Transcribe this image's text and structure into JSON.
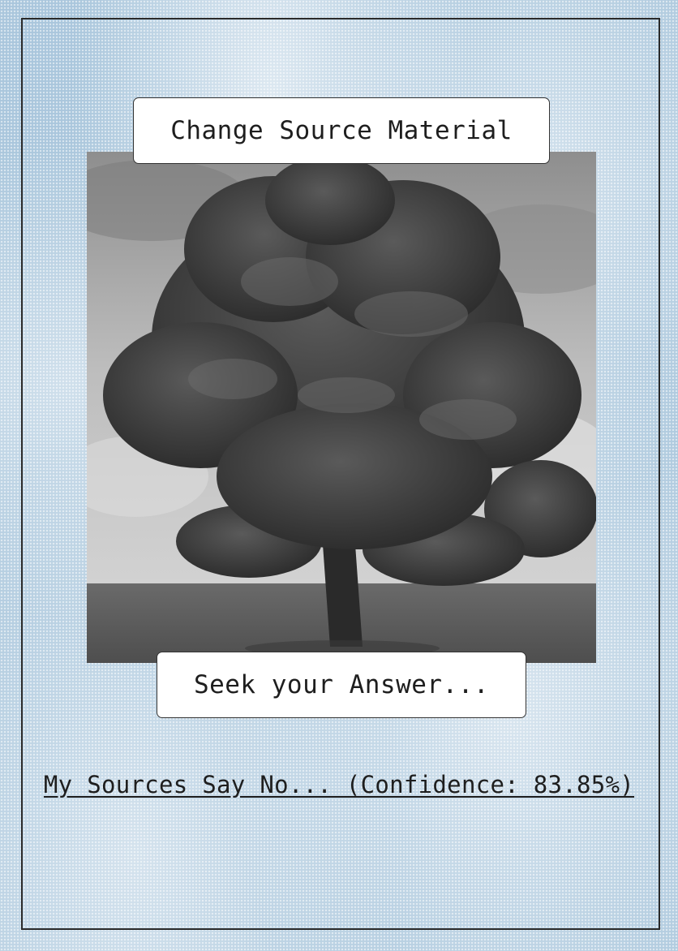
{
  "controls": {
    "change_source_label": "Change Source Material",
    "seek_answer_label": "Seek your Answer..."
  },
  "result": {
    "text": "My Sources Say No... (Confidence: 83.85%)"
  },
  "source_image": {
    "subject": "oak-tree-photo",
    "tone": "grayscale"
  },
  "colors": {
    "background": "#a9c6dc",
    "frame": "#2b2b2b",
    "button_bg": "#ffffff",
    "text": "#1e1e1e"
  }
}
